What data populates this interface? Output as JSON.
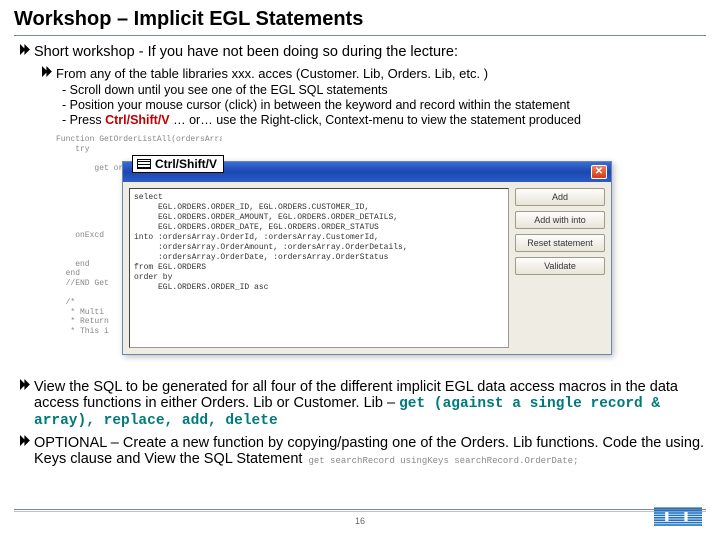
{
  "title": "Workshop – Implicit EGL Statements",
  "lvl1_intro": "Short workshop - If you have not been doing so during the lecture:",
  "lvl2_intro": "From any of the table libraries xxx. acces (Customer. Lib, Orders. Lib, etc. )",
  "lvl3_items": [
    "- Scroll down until you see one of the EGL SQL statements",
    "- Position  your mouse cursor (click) in between the keyword and record within the statement",
    "- Press "
  ],
  "lvl3_last_bold": "Ctrl/Shift/V",
  "lvl3_last_tail": " … or… use the Right-click, Context-menu to view the statement produced",
  "shortcut_label": "Ctrl/Shift/V",
  "code_bg": "Function GetOrderListAll(ordersArray Orders[]  out, status StatusRec)\n    try\n\n        get ordersArray;\n\n\n\n\n\n\n    onExcd\n\n\n    end\n  end\n  //END Get\n\n  /*\n   * Multi\n   * Return\n   * This i",
  "dialog": {
    "sql": "select\n     EGL.ORDERS.ORDER_ID, EGL.ORDERS.CUSTOMER_ID,\n     EGL.ORDERS.ORDER_AMOUNT, EGL.ORDERS.ORDER_DETAILS,\n     EGL.ORDERS.ORDER_DATE, EGL.ORDERS.ORDER_STATUS\ninto :ordersArray.OrderId, :ordersArray.CustomerId,\n     :ordersArray.OrderAmount, :ordersArray.OrderDetails,\n     :ordersArray.OrderDate, :ordersArray.OrderStatus\nfrom EGL.ORDERS\norder by\n     EGL.ORDERS.ORDER_ID asc",
    "buttons": [
      "Add",
      "Add with into",
      "Reset statement",
      "Validate"
    ]
  },
  "lvl1_view_pre": "View the SQL to be generated for all four of the different implicit EGL data access macros in the data access functions in either Orders. Lib or Customer. Lib – ",
  "lvl1_view_mono": "get (against a single record & array), replace, add, delete",
  "lvl1_optional_pre": "OPTIONAL – Create a new function by copying/pasting one of the Orders. Lib functions. Code the using. Keys clause and View the SQL Statement",
  "lvl1_optional_code": "get searchRecord usingKeys searchRecord.OrderDate;",
  "page_number": "16"
}
